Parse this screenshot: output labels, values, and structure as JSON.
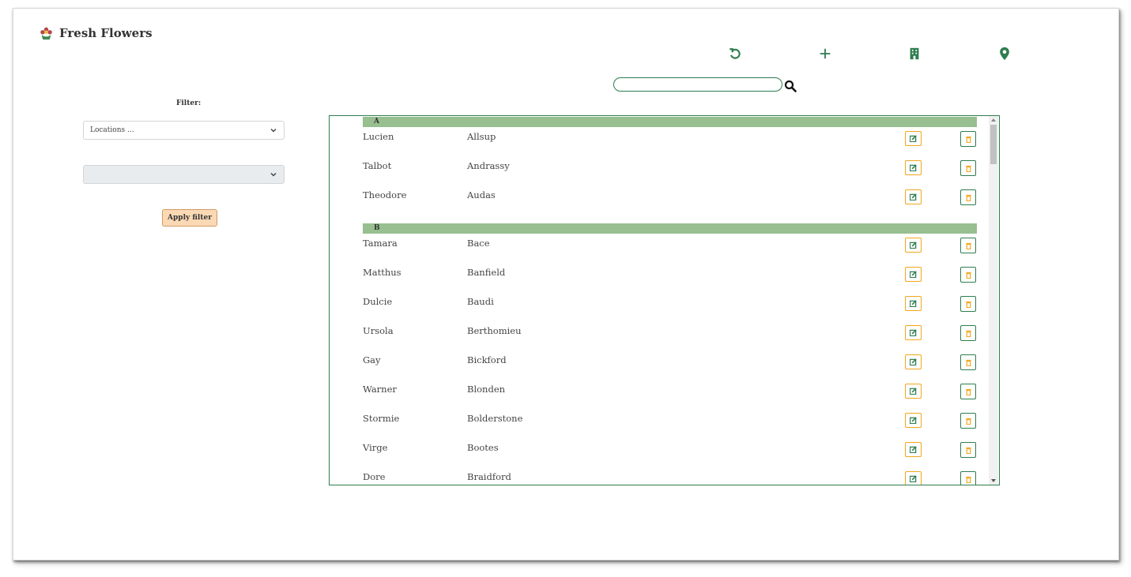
{
  "app": {
    "title": "Fresh Flowers"
  },
  "toolbar": {
    "refresh_icon": "refresh-icon",
    "add_icon": "plus-icon",
    "building_icon": "building-icon",
    "location_icon": "map-marker-icon"
  },
  "search": {
    "value": "",
    "placeholder": "",
    "icon": "search-icon"
  },
  "filter": {
    "label": "Filter:",
    "location_select": {
      "selected": "Locations ..."
    },
    "second_select": {
      "selected": ""
    },
    "apply_label": "Apply filter"
  },
  "colors": {
    "accent_green": "#2e7d4f",
    "group_header_bg": "#97bf8f",
    "edit_border": "#f2a71e",
    "apply_button_bg": "#fcd9b5"
  },
  "list": {
    "groups": [
      {
        "letter": "A",
        "people": [
          {
            "first": "Lucien",
            "last": "Allsup"
          },
          {
            "first": "Talbot",
            "last": "Andrassy"
          },
          {
            "first": "Theodore",
            "last": "Audas"
          }
        ]
      },
      {
        "letter": "B",
        "people": [
          {
            "first": "Tamara",
            "last": "Bace"
          },
          {
            "first": "Matthus",
            "last": "Banfield"
          },
          {
            "first": "Dulcie",
            "last": "Baudi"
          },
          {
            "first": "Ursola",
            "last": "Berthomieu"
          },
          {
            "first": "Gay",
            "last": "Bickford"
          },
          {
            "first": "Warner",
            "last": "Blonden"
          },
          {
            "first": "Stormie",
            "last": "Bolderstone"
          },
          {
            "first": "Virge",
            "last": "Bootes"
          },
          {
            "first": "Dore",
            "last": "Braidford"
          }
        ]
      }
    ],
    "row_actions": {
      "edit_icon": "edit-icon",
      "delete_icon": "trash-icon"
    }
  }
}
